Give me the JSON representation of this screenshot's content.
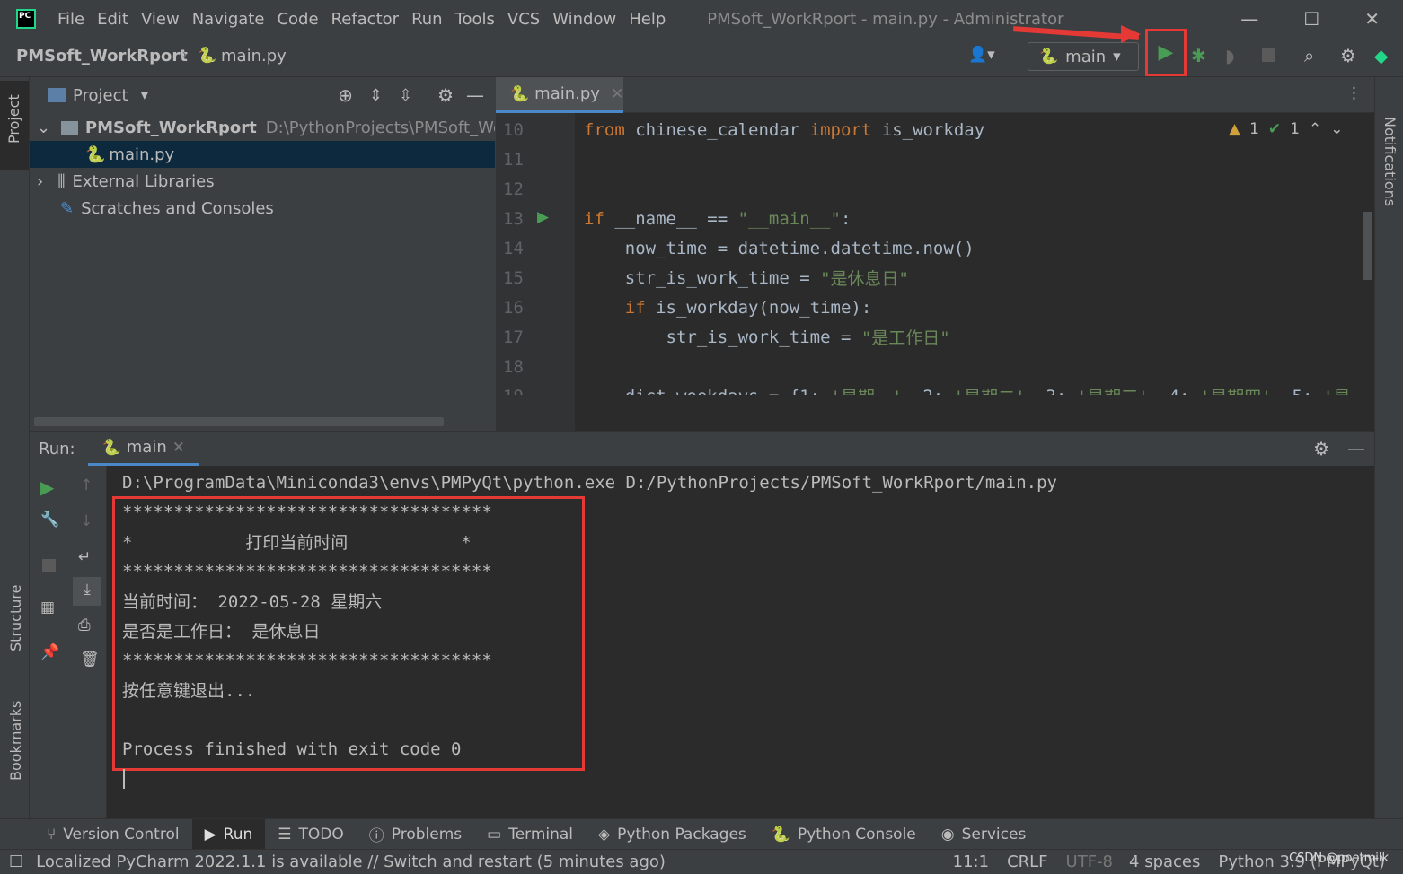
{
  "window": {
    "title": "PMSoft_WorkRport - main.py - Administrator",
    "menu": [
      "File",
      "Edit",
      "View",
      "Navigate",
      "Code",
      "Refactor",
      "Run",
      "Tools",
      "VCS",
      "Window",
      "Help"
    ]
  },
  "nav": {
    "project": "PMSoft_WorkRport",
    "file": "main.py",
    "run_config": "main"
  },
  "project_panel": {
    "title": "Project",
    "root": "PMSoft_WorkRport",
    "root_path": "D:\\PythonProjects\\PMSoft_Wor",
    "items": [
      "main.py",
      "External Libraries",
      "Scratches and Consoles"
    ]
  },
  "editor": {
    "tab": "main.py",
    "inspections": {
      "warnings": "1",
      "ok": "1"
    },
    "lines": [
      {
        "n": "10",
        "tokens": [
          [
            "kw",
            "from"
          ],
          [
            "pl",
            " chinese_calendar "
          ],
          [
            "kw",
            "import"
          ],
          [
            "pl",
            " is_workday"
          ]
        ]
      },
      {
        "n": "11",
        "tokens": []
      },
      {
        "n": "12",
        "tokens": []
      },
      {
        "n": "13",
        "tokens": [
          [
            "kw",
            "if"
          ],
          [
            "pl",
            " __name__ == "
          ],
          [
            "str",
            "\"__main__\""
          ],
          [
            "pl",
            ":"
          ]
        ]
      },
      {
        "n": "14",
        "tokens": [
          [
            "pl",
            "    now_time = datetime.datetime.now()"
          ]
        ]
      },
      {
        "n": "15",
        "tokens": [
          [
            "pl",
            "    str_is_work_time = "
          ],
          [
            "str",
            "\"是休息日\""
          ]
        ]
      },
      {
        "n": "16",
        "tokens": [
          [
            "kw",
            "    if"
          ],
          [
            "pl",
            " is_workday(now_time):"
          ]
        ]
      },
      {
        "n": "17",
        "tokens": [
          [
            "pl",
            "        str_is_work_time = "
          ],
          [
            "str",
            "\"是工作日\""
          ]
        ]
      },
      {
        "n": "18",
        "tokens": []
      },
      {
        "n": "19",
        "tokens": [
          [
            "pl",
            "    dict_weekdays = {1: "
          ],
          [
            "str",
            "'星期一'"
          ],
          [
            "pl",
            ", 2: "
          ],
          [
            "str",
            "'星期二'"
          ],
          [
            "pl",
            ", 3: "
          ],
          [
            "str",
            "'星期三'"
          ],
          [
            "pl",
            ", 4: "
          ],
          [
            "str",
            "'星期四'"
          ],
          [
            "pl",
            ", 5: "
          ],
          [
            "str",
            "'星"
          ]
        ]
      }
    ]
  },
  "run": {
    "label": "Run:",
    "tab": "main",
    "output": [
      "D:\\ProgramData\\Miniconda3\\envs\\PMPyQt\\python.exe D:/PythonProjects/PMSoft_WorkRport/main.py",
      "************************************",
      "*           打印当前时间           *",
      "************************************",
      "当前时间： 2022-05-28 星期六",
      "是否是工作日： 是休息日",
      "************************************",
      "按任意键退出...",
      "",
      "Process finished with exit code 0"
    ]
  },
  "side_left": [
    "Project",
    "Structure",
    "Bookmarks"
  ],
  "side_right": [
    "Notifications"
  ],
  "bottom_tabs": [
    "Version Control",
    "Run",
    "TODO",
    "Problems",
    "Terminal",
    "Python Packages",
    "Python Console",
    "Services"
  ],
  "status": {
    "message": "Localized PyCharm 2022.1.1 is available // Switch and restart (5 minutes ago)",
    "position": "11:1",
    "line_sep": "CRLF",
    "encoding": "UTF-8",
    "indent": "4 spaces",
    "interpreter": "Python 3.9 (PMPyQt)",
    "watermark": "CSDN @poetmilk"
  },
  "colors": {
    "highlight": "#e53935",
    "run_green": "#499c54",
    "selection": "#0d293e"
  }
}
